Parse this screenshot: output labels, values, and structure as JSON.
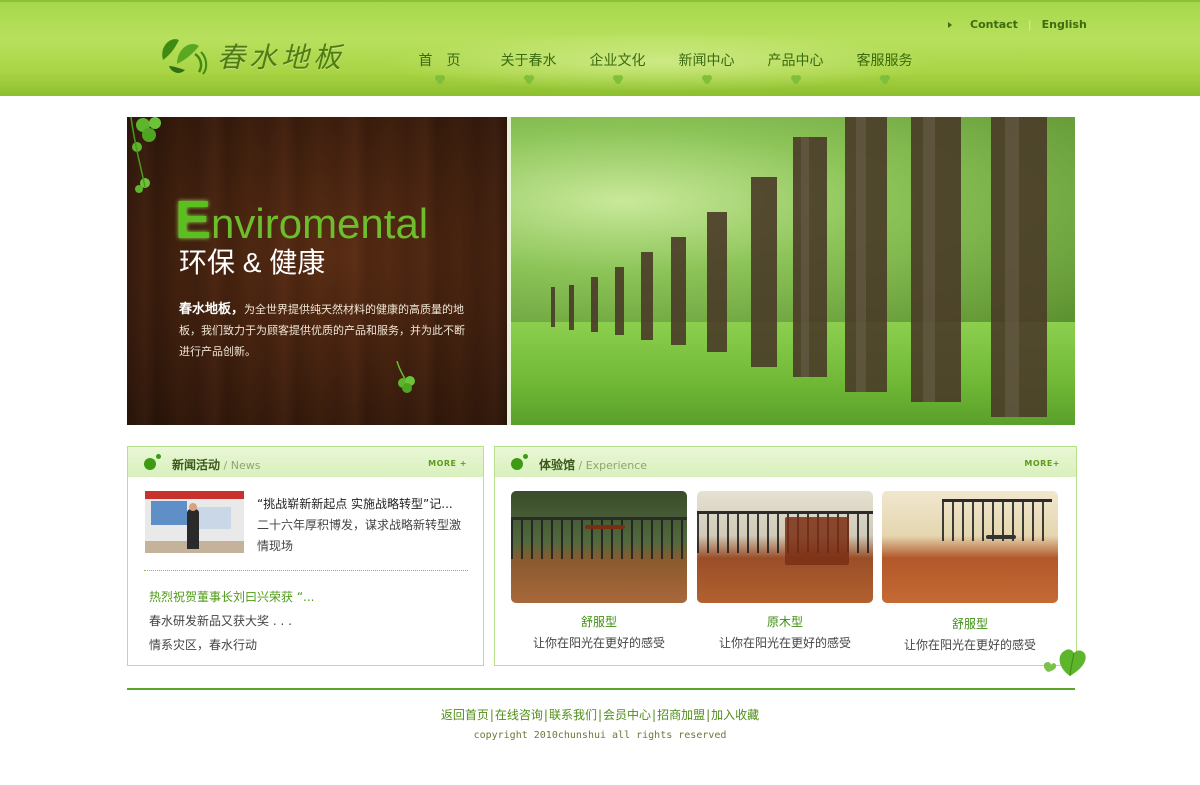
{
  "header": {
    "logo_text": "春水地板",
    "top_links": [
      "Contact",
      "English"
    ],
    "nav": [
      "首　页",
      "关于春水",
      "企业文化",
      "新闻中心",
      "产品中心",
      "客服服务"
    ]
  },
  "banner": {
    "title_initial": "E",
    "title_rest": "nviromental",
    "subtitle": "环保 & 健康",
    "desc_brand": "春水地板，",
    "desc_text": "为全世界提供纯天然材料的健康的高质量的地板，我们致力于为顾客提供优质的产品和服务，并为此不断进行产品创新。"
  },
  "news": {
    "title": "新闻活动",
    "title_en": "News",
    "slash": " / ",
    "more": "MORE +",
    "top_title": "“挑战崭新新起点 实施战略转型”记...",
    "top_desc": "二十六年厚积博发，谋求战略新转型激情现场",
    "items": [
      "热烈祝贺董事长刘曰兴荣获 “...",
      "春水研发新品又获大奖 . . .",
      "情系灾区，春水行动"
    ]
  },
  "experience": {
    "title": "体验馆",
    "title_en": "Experience",
    "slash": " / ",
    "more": "MORE+",
    "items": [
      {
        "name": "舒服型",
        "desc": "让你在阳光在更好的感受"
      },
      {
        "name": "原木型",
        "desc": "让你在阳光在更好的感受"
      },
      {
        "name": "舒服型",
        "desc": "让你在阳光在更好的感受"
      }
    ]
  },
  "footer": {
    "links": [
      "返回首页",
      "在线咨询",
      "联系我们",
      "会员中心",
      "招商加盟",
      "加入收藏"
    ],
    "copyright": "copyright 2010chunshui all rights reserved"
  },
  "colors": {
    "header_green": "#a6d84b",
    "accent_green": "#4f9a16",
    "wood_dark": "#3b1d0f"
  }
}
